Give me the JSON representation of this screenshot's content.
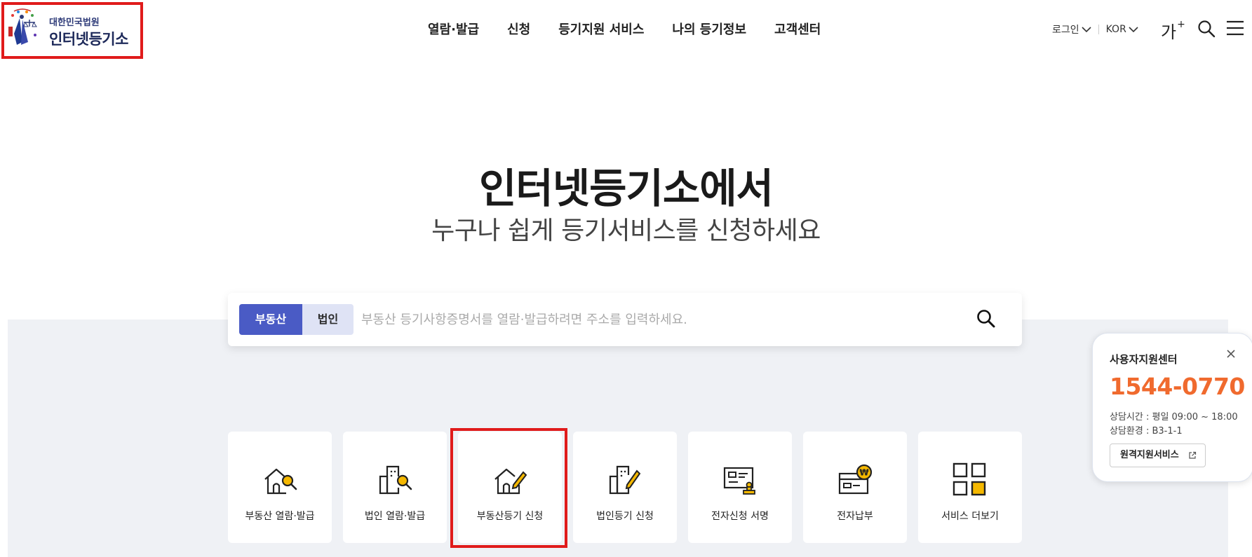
{
  "header": {
    "logo_subtitle": "대한민국법원",
    "logo_title": "인터넷등기소",
    "nav": [
      "열람·발급",
      "신청",
      "등기지원 서비스",
      "나의 등기정보",
      "고객센터"
    ],
    "login_label": "로그인",
    "lang_label": "KOR",
    "font_size_label": "가",
    "font_size_plus": "+"
  },
  "hero": {
    "title": "인터넷등기소에서",
    "subtitle": "누구나 쉽게 등기서비스를 신청하세요"
  },
  "search": {
    "tabs": [
      "부동산",
      "법인"
    ],
    "active_tab": "부동산",
    "placeholder": "부동산 등기사항증명서를 열람·발급하려면 주소를 입력하세요.",
    "value": ""
  },
  "services": [
    {
      "label": "부동산 열람·발급",
      "icon": "house-search-icon"
    },
    {
      "label": "법인 열람·발급",
      "icon": "building-search-icon"
    },
    {
      "label": "부동산등기 신청",
      "icon": "house-edit-icon"
    },
    {
      "label": "법인등기 신청",
      "icon": "building-edit-icon"
    },
    {
      "label": "전자신청 서명",
      "icon": "stamp-document-icon"
    },
    {
      "label": "전자납부",
      "icon": "wallet-won-icon"
    },
    {
      "label": "서비스 더보기",
      "icon": "grid-more-icon"
    }
  ],
  "support": {
    "title": "사용자지원센터",
    "phone": "1544-0770",
    "hours": "상담시간 : 평일 09:00 ~ 18:00",
    "environment": "상담환경 : B3-1-1",
    "remote_label": "원격지원서비스"
  },
  "colors": {
    "primary": "#4a5bc5",
    "accent_yellow": "#f5b800",
    "phone_orange": "#f06a2e",
    "highlight_red": "#e01b1b",
    "band_gray": "#eff1f5"
  }
}
